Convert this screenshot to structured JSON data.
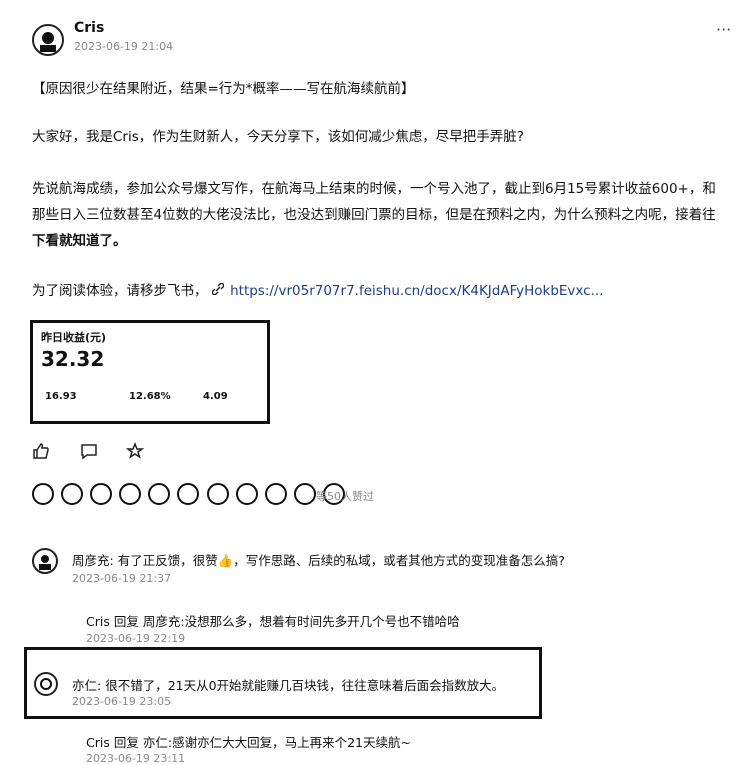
{
  "post": {
    "author": "Cris",
    "timestamp": "2023-06-19 21:04",
    "more_label": "···",
    "title": "【原因很少在结果附近，结果=行为*概率——写在航海续航前】",
    "paragraph1": "大家好，我是Cris，作为生财新人，今天分享下，该如何减少焦虑，尽早把手弄脏?",
    "paragraph2_line1": "先说航海成绩，参加公众号爆文写作，在航海马上结束的时候，一个号入池了，截止到6月15号累计收益600+，和",
    "paragraph2_line2": "那些日入三位数甚至4位数的大佬没法比，也没达到赚回门票的目标，但是在预料之内，为什么预料之内呢，接着往",
    "paragraph2_line3": "下看就知道了。",
    "link_prefix": "为了阅读体验，请移步飞书，",
    "link_icon": "link-icon",
    "link_url": "https://vr05r707r7.feishu.cn/docx/K4KJdAFyHokbEvxc..."
  },
  "stats_card": {
    "label": "昨日收益(元)",
    "value": "32.32",
    "sub1": "16.93",
    "sub2": "12.68%",
    "sub3": "4.09"
  },
  "actions": {
    "like_icon": "thumb-up-icon",
    "comment_icon": "comment-icon",
    "share_icon": "star-icon"
  },
  "reactions": {
    "count_text": "等50人赞过"
  },
  "comments": [
    {
      "author": "周彦充",
      "text": "有了正反馈，很赞👍，写作思路、后续的私域，或者其他方式的变现准备怎么搞?",
      "timestamp": "2023-06-19 21:37"
    },
    {
      "author": "亦仁",
      "text": "很不错了，21天从0开始就能赚几百块钱，往往意味着后面会指数放大。",
      "timestamp": "2023-06-19 23:05"
    }
  ],
  "replies": [
    {
      "author": "Cris",
      "reply_word": "回复",
      "target": "周彦充:",
      "text": "没想那么多，想着有时间先多开几个号也不错哈哈",
      "timestamp": "2023-06-19 22:19"
    },
    {
      "author": "Cris",
      "reply_word": "回复",
      "target": "亦仁:",
      "text": "感谢亦仁大大回复，马上再来个21天续航~",
      "timestamp": "2023-06-19 23:11"
    }
  ]
}
